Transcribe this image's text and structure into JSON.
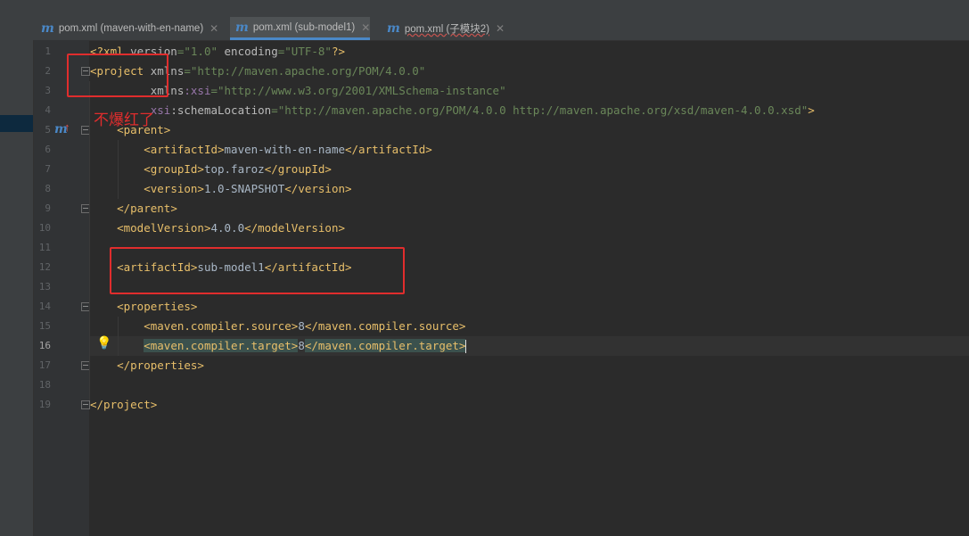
{
  "tabs": [
    {
      "label": "pom.xml (maven-with-en-name)",
      "icon": "maven-m-icon",
      "active": false
    },
    {
      "label": "pom.xml (sub-model1)",
      "icon": "maven-m-icon",
      "active": true
    },
    {
      "label": "pom.xml (子模块2)",
      "icon": "maven-m-icon",
      "active": false
    }
  ],
  "editor": {
    "line_numbers": [
      "1",
      "2",
      "3",
      "4",
      "5",
      "6",
      "7",
      "8",
      "9",
      "10",
      "11",
      "12",
      "13",
      "14",
      "15",
      "16",
      "17",
      "18",
      "19"
    ],
    "current_line": "16"
  },
  "annotation": {
    "note_text": "不爆红了",
    "box_color": "#e02d2d"
  },
  "colors": {
    "tag": "#e8bf6a",
    "value": "#6a8759",
    "namespace": "#9876aa",
    "accent": "#4a88c7"
  }
}
